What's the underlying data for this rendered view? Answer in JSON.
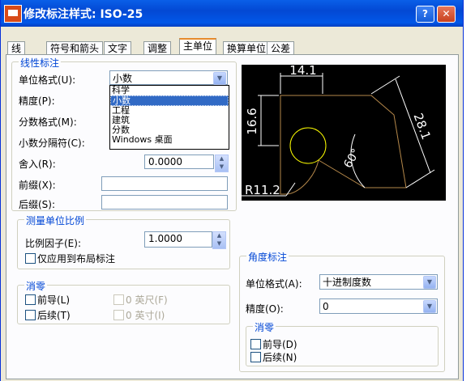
{
  "window": {
    "title": "修改标注样式: ISO-25",
    "help_label": "?",
    "close_label": "✕"
  },
  "tabs": [
    "线",
    "符号和箭头",
    "文字",
    "调整",
    "主单位",
    "换算单位",
    "公差"
  ],
  "linear": {
    "group_title": "线性标注",
    "unit_format_label": "单位格式(U):",
    "unit_format_value": "小数",
    "unit_format_options": [
      "科学",
      "小数",
      "工程",
      "建筑",
      "分数",
      "Windows 桌面"
    ],
    "precision_label": "精度(P):",
    "fraction_format_label": "分数格式(M):",
    "decimal_sep_label": "小数分隔符(C):",
    "round_label": "舍入(R):",
    "round_value": "0.0000",
    "prefix_label": "前缀(X):",
    "suffix_label": "后缀(S):"
  },
  "scale": {
    "group_title": "测量单位比例",
    "factor_label": "比例因子(E):",
    "factor_value": "1.0000",
    "layout_only_label": "仅应用到布局标注"
  },
  "zero_linear": {
    "group_title": "消零",
    "leading_label": "前导(L)",
    "trailing_label": "后续(T)",
    "feet_label": "0 英尺(F)",
    "inches_label": "0 英寸(I)"
  },
  "angular": {
    "group_title": "角度标注",
    "unit_format_label": "单位格式(A):",
    "unit_format_value": "十进制度数",
    "precision_label": "精度(O):",
    "precision_value": "0",
    "zero_title": "消零",
    "leading_label": "前导(D)",
    "trailing_label": "后续(N)"
  },
  "preview": {
    "dim_top": "14.1",
    "dim_left": "16.6",
    "dim_right": "28.1",
    "dim_angle": "60°",
    "dim_radius": "R11.2"
  }
}
